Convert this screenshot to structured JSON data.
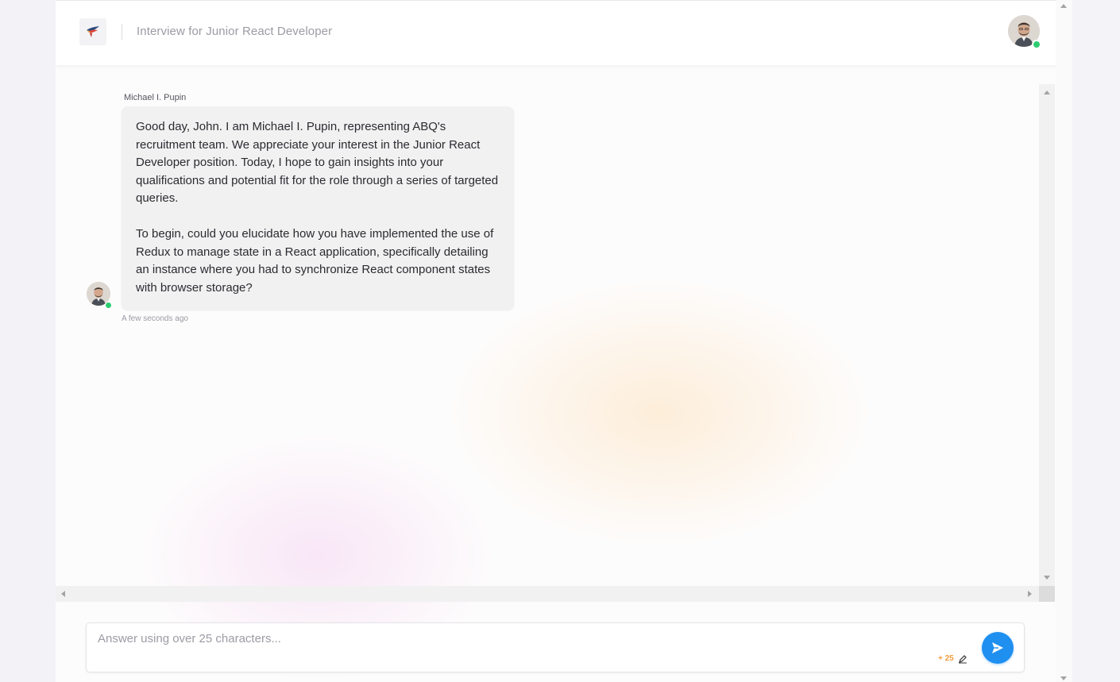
{
  "header": {
    "title": "Interview for Junior React Developer"
  },
  "message": {
    "sender": "Michael I. Pupin",
    "text": "Good day, John. I am Michael I. Pupin, representing ABQ's recruitment team. We appreciate your interest in the Junior React Developer position. Today, I hope to gain insights into your qualifications and potential fit for the role through a series of targeted queries.\n\nTo begin, could you elucidate how you have implemented the use of Redux to manage state in a React application, specifically detailing an instance where you had to synchronize React component states with browser storage?",
    "timestamp": "A few seconds ago"
  },
  "composer": {
    "placeholder": "Answer using over 25 characters...",
    "value": "",
    "char_count": "+ 25"
  },
  "colors": {
    "accent": "#1f8ff0",
    "online": "#2ecc71",
    "counter": "#f39c3a"
  },
  "icons": {
    "logo": "bird-logo-icon",
    "send": "send-icon",
    "pen": "pen-icon"
  }
}
